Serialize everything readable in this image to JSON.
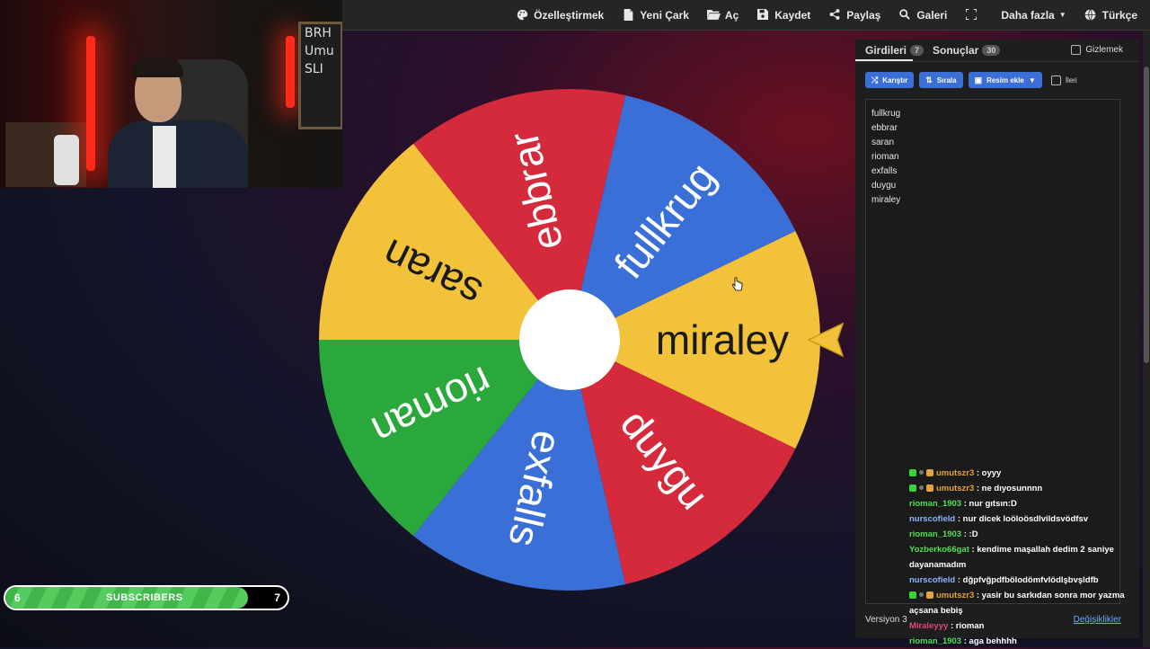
{
  "navbar": {
    "items": [
      {
        "label": "Özelleştirmek",
        "icon": "palette-icon"
      },
      {
        "label": "Yeni Çark",
        "icon": "file-icon"
      },
      {
        "label": "Aç",
        "icon": "folder-icon"
      },
      {
        "label": "Kaydet",
        "icon": "save-icon"
      },
      {
        "label": "Paylaş",
        "icon": "share-icon"
      },
      {
        "label": "Galeri",
        "icon": "search-icon"
      },
      {
        "label": "",
        "icon": "fullscreen-icon"
      },
      {
        "label": "Daha fazla",
        "icon": "chevron-down-icon"
      },
      {
        "label": "Türkçe",
        "icon": "globe-icon"
      }
    ]
  },
  "webcam": {
    "board_lines": [
      "BRH",
      "Umu",
      "SLI"
    ]
  },
  "wheel": {
    "segments": [
      {
        "label": "miraley",
        "color": "#f2c33a"
      },
      {
        "label": "duygu",
        "color": "#d42a3c"
      },
      {
        "label": "exfalls",
        "color": "#3a6fd8"
      },
      {
        "label": "rioman",
        "color": "#2ba83c"
      },
      {
        "label": "saran",
        "color": "#f2c33a"
      },
      {
        "label": "ebbrar",
        "color": "#d42a3c"
      },
      {
        "label": "fullkrug",
        "color": "#3a6fd8"
      }
    ],
    "pointer_color": "#f2c33a"
  },
  "panel": {
    "tab_entries": "Girdileri",
    "tab_entries_count": "7",
    "tab_results": "Sonuçlar",
    "tab_results_count": "30",
    "hide_label": "Gizlemek",
    "shuffle_label": "Karıştır",
    "sort_label": "Sırala",
    "add_image_label": "Resim ekle",
    "advanced_label": "İleri",
    "entries": [
      "fullkrug",
      "ebbrar",
      "saran",
      "rioman",
      "exfalls",
      "duygu",
      "miraley"
    ],
    "version_label": "Versiyon 3",
    "changes_label": "Değişiklikler"
  },
  "chat": {
    "messages": [
      {
        "user": "umutszr3",
        "color": "#e6a23c",
        "text": ": oyyy",
        "badges": true
      },
      {
        "user": "umutszr3",
        "color": "#e6a23c",
        "text": ": ne dıyosunnnn",
        "badges": true
      },
      {
        "user": "rioman_1903",
        "color": "#4ee04e",
        "text": ": nur gıtsın:D",
        "badges": false
      },
      {
        "user": "nurscofield",
        "color": "#8ab4ff",
        "text": ": nur dicek loöloösdlvildsvödfsv",
        "badges": false
      },
      {
        "user": "rioman_1903",
        "color": "#4ee04e",
        "text": ": :D",
        "badges": false
      },
      {
        "user": "Yozberko66gat",
        "color": "#4ee04e",
        "text": ": kendime maşallah dedim 2 saniye dayanamadım",
        "badges": false
      },
      {
        "user": "nurscofield",
        "color": "#8ab4ff",
        "text": ": dğpfvğpdfbölodömfvlödlşbvşldfb",
        "badges": false
      },
      {
        "user": "umutszr3",
        "color": "#e6a23c",
        "text": ": yasir bu sarkıdan sonra mor yazma açsana bebiş",
        "badges": true
      },
      {
        "user": "Miraleyyy",
        "color": "#e04a7a",
        "text": ": rioman",
        "badges": false
      },
      {
        "user": "rioman_1903",
        "color": "#4ee04e",
        "text": ": aga behhhh",
        "badges": false
      }
    ]
  },
  "subscribers": {
    "current": "6",
    "label": "SUBSCRIBERS",
    "goal": "7",
    "progress_fraction": 0.86
  }
}
